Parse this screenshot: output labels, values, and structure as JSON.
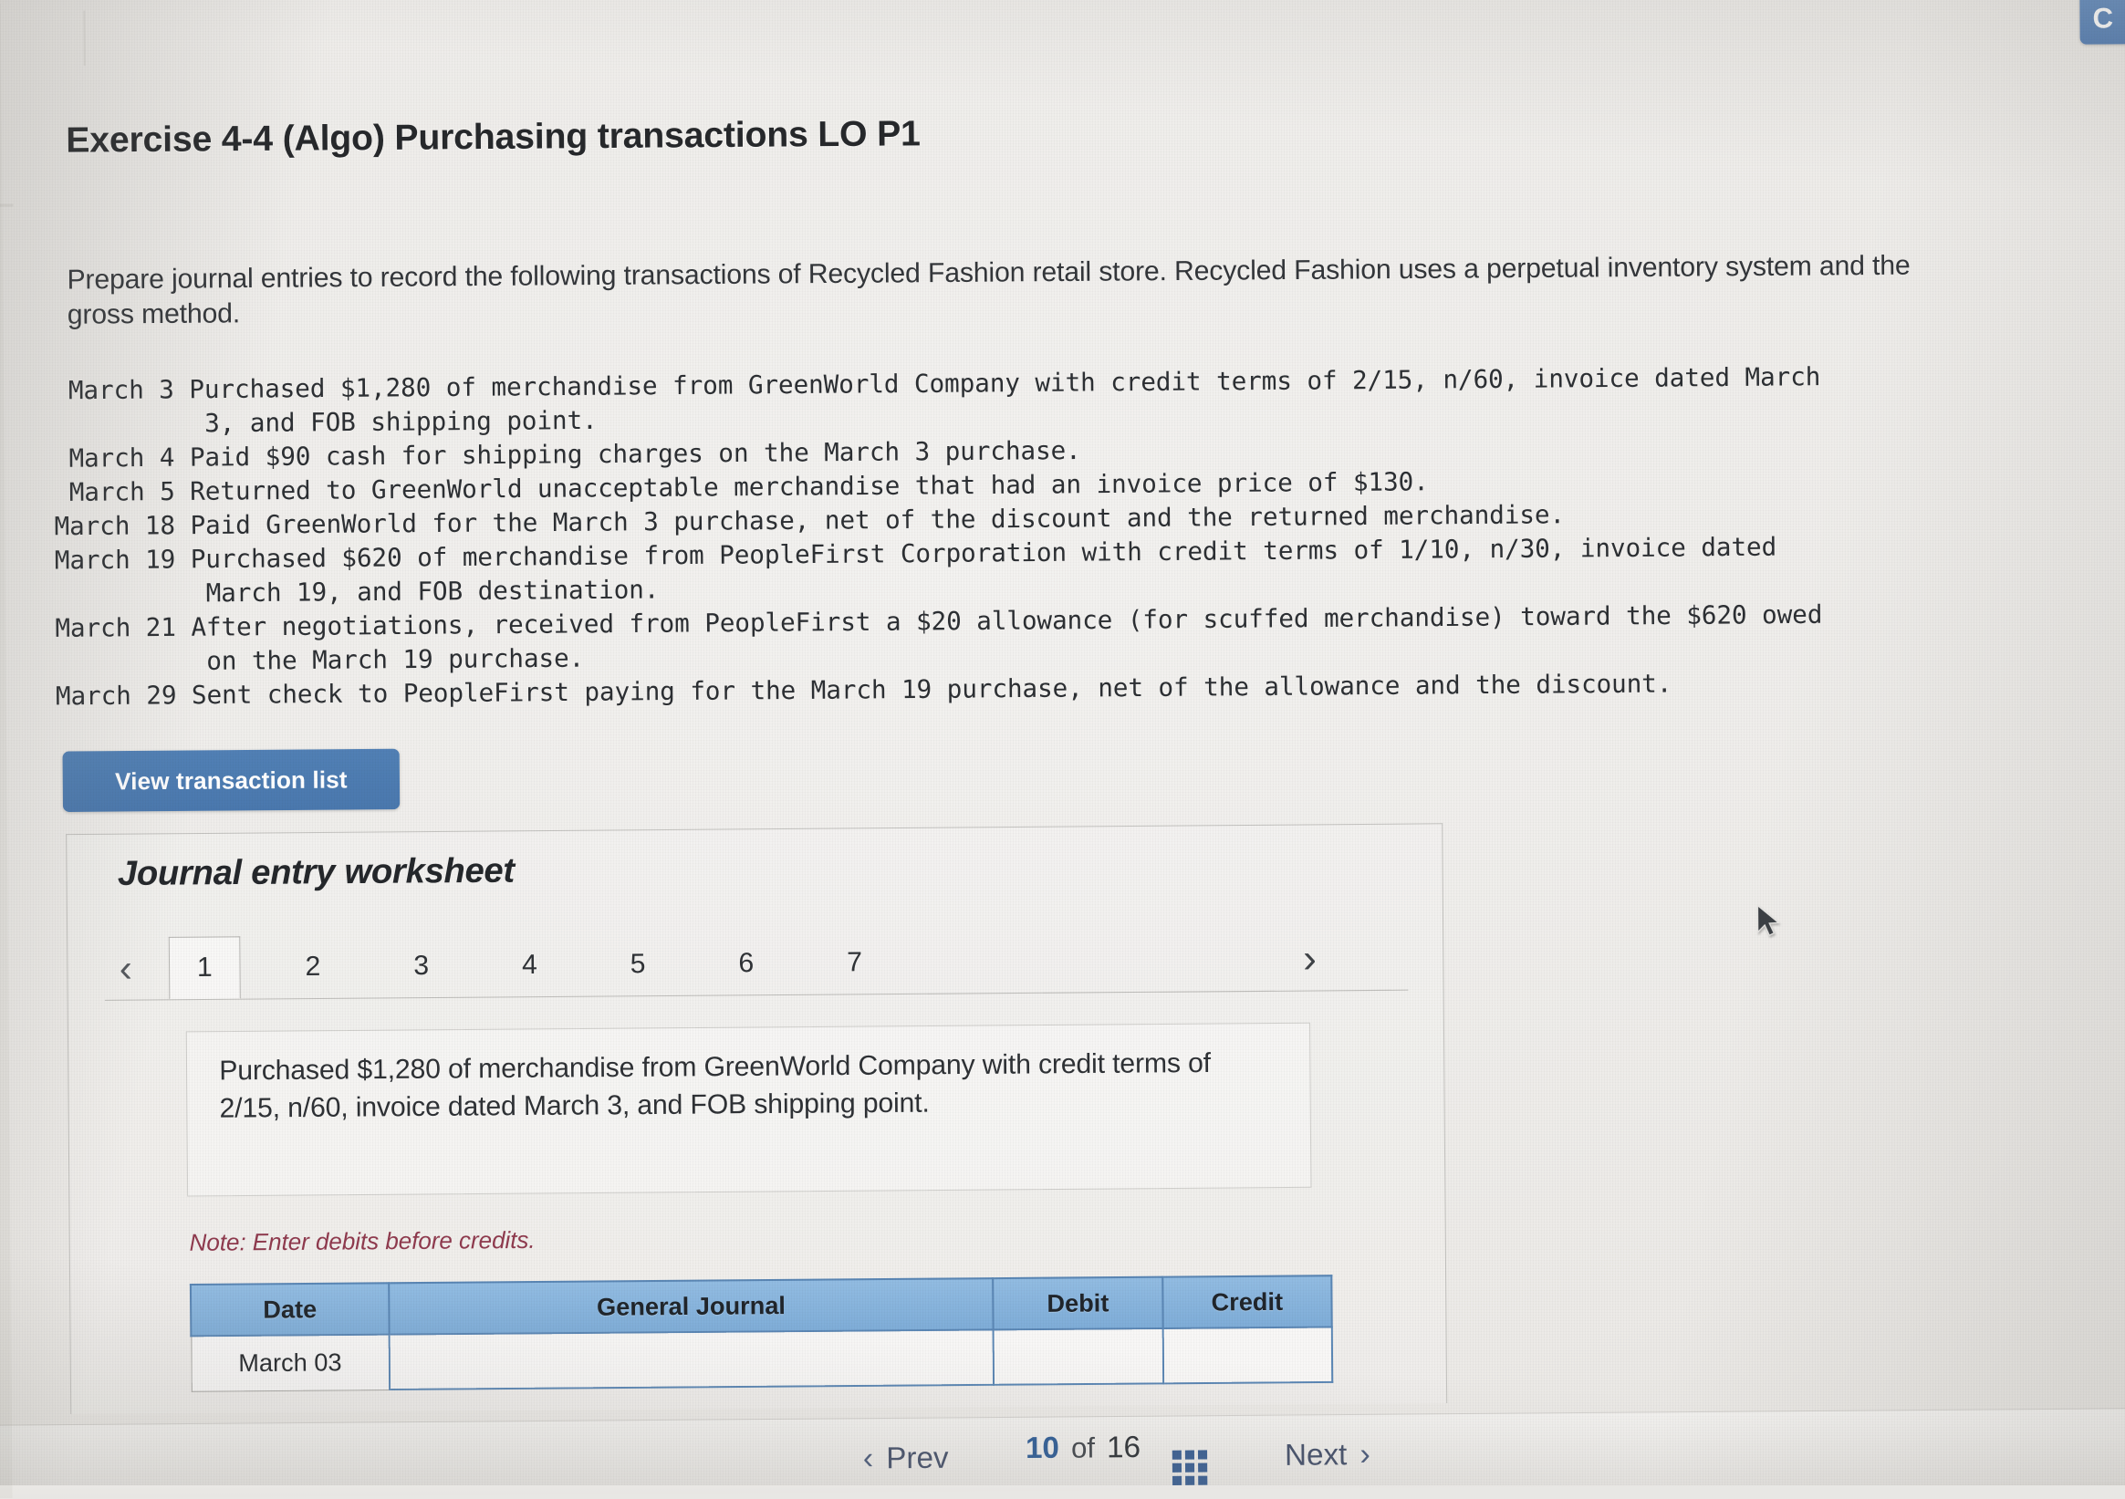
{
  "corner": {
    "button_label": "C"
  },
  "header": {
    "title": "Exercise 4-4 (Algo) Purchasing transactions LO P1"
  },
  "intro": {
    "text": "Prepare journal entries to record the following transactions of Recycled Fashion retail store. Recycled Fashion uses a perpetual inventory system and the gross method."
  },
  "transactions": {
    "text": " March 3 Purchased $1,280 of merchandise from GreenWorld Company with credit terms of 2/15, n/60, invoice dated March\n          3, and FOB shipping point.\n March 4 Paid $90 cash for shipping charges on the March 3 purchase.\n March 5 Returned to GreenWorld unacceptable merchandise that had an invoice price of $130.\nMarch 18 Paid GreenWorld for the March 3 purchase, net of the discount and the returned merchandise.\nMarch 19 Purchased $620 of merchandise from PeopleFirst Corporation with credit terms of 1/10, n/30, invoice dated\n          March 19, and FOB destination.\nMarch 21 After negotiations, received from PeopleFirst a $20 allowance (for scuffed merchandise) toward the $620 owed\n          on the March 19 purchase.\nMarch 29 Sent check to PeopleFirst paying for the March 19 purchase, net of the allowance and the discount.",
    "lines": [
      " March 3 Purchased $1,280 of merchandise from GreenWorld Company with credit terms of 2/15, n/60, invoice dated March",
      "          3, and FOB shipping point.",
      " March 4 Paid $90 cash for shipping charges on the March 3 purchase.",
      " March 5 Returned to GreenWorld unacceptable merchandise that had an invoice price of $130.",
      "March 18 Paid GreenWorld for the March 3 purchase, net of the discount and the returned merchandise.",
      "March 19 Purchased $620 of merchandise from PeopleFirst Corporation with credit terms of 1/10, n/30, invoice dated",
      "          March 19, and FOB destination.",
      "March 21 After negotiations, received from PeopleFirst a $20 allowance (for scuffed merchandise) toward the $620 owed",
      "          on the March 19 purchase.",
      "March 29 Sent check to PeopleFirst paying for the March 19 purchase, net of the allowance and the discount."
    ]
  },
  "view_transaction_button": {
    "label": "View transaction list"
  },
  "worksheet": {
    "title": "Journal entry worksheet",
    "prev_arrow": "‹",
    "next_arrow": "›",
    "tabs": [
      {
        "label": "1",
        "active": true
      },
      {
        "label": "2",
        "active": false
      },
      {
        "label": "3",
        "active": false
      },
      {
        "label": "4",
        "active": false
      },
      {
        "label": "5",
        "active": false
      },
      {
        "label": "6",
        "active": false
      },
      {
        "label": "7",
        "active": false
      }
    ],
    "description": "Purchased $1,280 of merchandise from GreenWorld Company with credit terms of 2/15, n/60, invoice dated March 3, and FOB shipping point.",
    "note": "Note: Enter debits before credits.",
    "table": {
      "headers": [
        "Date",
        "General Journal",
        "Debit",
        "Credit"
      ],
      "rows": [
        {
          "date": "March 03",
          "general_journal": "",
          "debit": "",
          "credit": ""
        }
      ]
    },
    "colors": {
      "header_blue": "#7fadd8",
      "header_border": "#5a86b4",
      "note_red": "#8f3a4e",
      "button_blue": "#4a78ae"
    }
  },
  "bottom_nav": {
    "prev_label": "Prev",
    "prev_chevron": "‹",
    "next_label": "Next",
    "next_chevron": "›",
    "current_page": "10",
    "of_label": "of",
    "total_pages": "16",
    "grid_icon_name": "grid-icon"
  }
}
